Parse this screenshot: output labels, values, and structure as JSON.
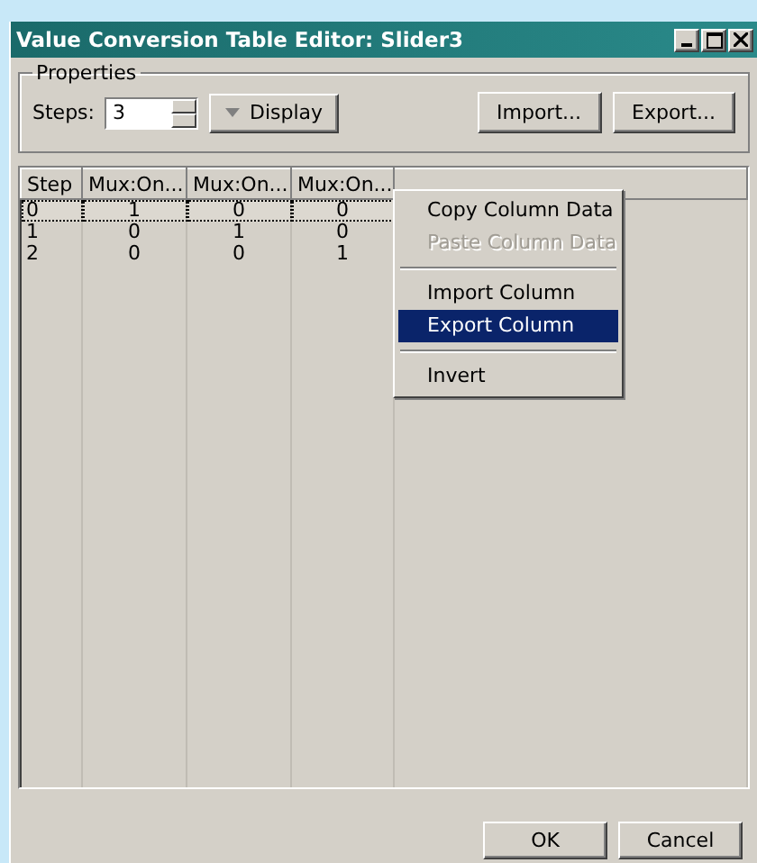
{
  "window": {
    "title": "Value Conversion Table Editor: Slider3"
  },
  "properties": {
    "legend": "Properties",
    "steps_label": "Steps:",
    "steps_value": "3",
    "display_button": "Display",
    "import_button": "Import...",
    "export_button": "Export..."
  },
  "table": {
    "columns": [
      "Step",
      "Mux:On...",
      "Mux:On...",
      "Mux:On..."
    ],
    "rows": [
      {
        "cells": [
          "0",
          "1",
          "0",
          "0"
        ],
        "selected": true
      },
      {
        "cells": [
          "1",
          "0",
          "1",
          "0"
        ],
        "selected": false
      },
      {
        "cells": [
          "2",
          "0",
          "0",
          "1"
        ],
        "selected": false
      }
    ]
  },
  "context_menu": {
    "items": [
      {
        "kind": "item",
        "label": "Copy Column Data",
        "disabled": false,
        "selected": false
      },
      {
        "kind": "item",
        "label": "Paste Column Data",
        "disabled": true,
        "selected": false
      },
      {
        "kind": "separator"
      },
      {
        "kind": "item",
        "label": "Import Column",
        "disabled": false,
        "selected": false
      },
      {
        "kind": "item",
        "label": "Export Column",
        "disabled": false,
        "selected": true
      },
      {
        "kind": "separator"
      },
      {
        "kind": "item",
        "label": "Invert",
        "disabled": false,
        "selected": false
      }
    ]
  },
  "buttons": [
    "OK",
    "Cancel"
  ]
}
